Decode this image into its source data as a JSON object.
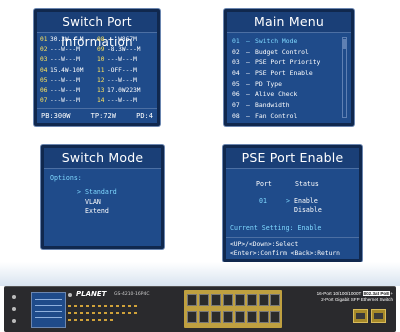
{
  "switch_port_info": {
    "title": "Switch Port Information",
    "rows": [
      [
        {
          "port": "01",
          "value": "30.3W"
        },
        {
          "port": "08",
          "value": "---W"
        },
        {
          "port": "",
          "value": "867M"
        },
        {
          "port": "",
          "value": ""
        }
      ],
      [
        {
          "port": "02",
          "value": "---W"
        },
        {
          "port": "",
          "value": "---M"
        },
        {
          "port": "09",
          "value": "-8.3W"
        },
        {
          "port": "",
          "value": "---M"
        }
      ],
      [
        {
          "port": "03",
          "value": "---W"
        },
        {
          "port": "",
          "value": "---M"
        },
        {
          "port": "10",
          "value": "---W"
        },
        {
          "port": "",
          "value": "---M"
        }
      ],
      [
        {
          "port": "04",
          "value": "15.4W"
        },
        {
          "port": "",
          "value": "10M"
        },
        {
          "port": "11",
          "value": "-OFF"
        },
        {
          "port": "",
          "value": "---M"
        }
      ],
      [
        {
          "port": "05",
          "value": "---W"
        },
        {
          "port": "",
          "value": "---M"
        },
        {
          "port": "12",
          "value": "---W"
        },
        {
          "port": "",
          "value": "---M"
        }
      ],
      [
        {
          "port": "06",
          "value": "---W"
        },
        {
          "port": "",
          "value": "---M"
        },
        {
          "port": "13",
          "value": "17.0W"
        },
        {
          "port": "",
          "value": "223M"
        }
      ],
      [
        {
          "port": "07",
          "value": "---W"
        },
        {
          "port": "",
          "value": "---M"
        },
        {
          "port": "14",
          "value": "---W"
        },
        {
          "port": "",
          "value": "---M"
        }
      ]
    ],
    "rows_text": [
      {
        "a_num": "01",
        "a_val": "30.3W---M",
        "b_num": "08",
        "b_val": "---W867M"
      },
      {
        "a_num": "02",
        "a_val": "---W---M",
        "b_num": "09",
        "b_val": "-8.3W---M"
      },
      {
        "a_num": "03",
        "a_val": "---W---M",
        "b_num": "10",
        "b_val": "---W---M"
      },
      {
        "a_num": "04",
        "a_val": "15.4W-10M",
        "b_num": "11",
        "b_val": "-OFF---M"
      },
      {
        "a_num": "05",
        "a_val": "---W---M",
        "b_num": "12",
        "b_val": "---W---M"
      },
      {
        "a_num": "06",
        "a_val": "---W---M",
        "b_num": "13",
        "b_val": "17.0W223M"
      },
      {
        "a_num": "07",
        "a_val": "---W---M",
        "b_num": "14",
        "b_val": "---W---M"
      }
    ],
    "footer": {
      "pb": "PB:300W",
      "tp": "TP:72W",
      "pd": "PD:4"
    }
  },
  "main_menu": {
    "title": "Main Menu",
    "items": [
      {
        "num": "01",
        "label": "Switch Mode"
      },
      {
        "num": "02",
        "label": "Budget Control"
      },
      {
        "num": "03",
        "label": "PSE Port Priority"
      },
      {
        "num": "04",
        "label": "PSE Port Enable"
      },
      {
        "num": "05",
        "label": "PD Type"
      },
      {
        "num": "06",
        "label": "Alive Check"
      },
      {
        "num": "07",
        "label": "Bandwidth"
      },
      {
        "num": "08",
        "label": "Fan Control"
      }
    ]
  },
  "switch_mode": {
    "title": "Switch Mode",
    "options_label": "Options:",
    "options": [
      {
        "marker": ">",
        "label": "Standard"
      },
      {
        "marker": "",
        "label": "VLAN"
      },
      {
        "marker": "",
        "label": "Extend"
      }
    ]
  },
  "pse_port_enable": {
    "title": "PSE Port Enable",
    "col_port": "Port",
    "col_status": "Status",
    "port": "01",
    "marker": ">",
    "status_options": [
      "Enable",
      "Disable"
    ],
    "current_setting": "Current Setting: Enable",
    "help": [
      "<UP>/<Down>:Select",
      "<Enter>:Confirm <Back>:Return"
    ]
  },
  "device": {
    "brand": "PLANET",
    "model": "GS-4210-16P4C",
    "spec_line1": "16-Port 10/100/1000T",
    "spec_badge": "802.3at PoE",
    "spec_line2": "+",
    "spec_line3": "2-Port Gigabit SFP Ethernet Switch"
  },
  "colors": {
    "screen_bg": "#1f4b8a",
    "accent": "#7fd8ff",
    "port_number": "#ffe45c"
  }
}
